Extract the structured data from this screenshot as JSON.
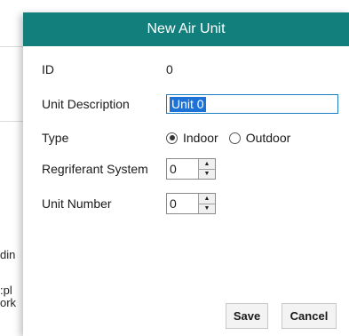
{
  "background": {
    "text_lines": [
      "din",
      ":pl",
      "ork"
    ]
  },
  "dialog": {
    "title": "New Air Unit",
    "id": {
      "label": "ID",
      "value": "0"
    },
    "unit_description": {
      "label": "Unit Description",
      "value": "Unit 0"
    },
    "type": {
      "label": "Type",
      "options": [
        "Indoor",
        "Outdoor"
      ],
      "selected": "Indoor"
    },
    "refrigerant_system": {
      "label": "Regriferant System",
      "value": "0"
    },
    "unit_number": {
      "label": "Unit Number",
      "value": "0"
    },
    "buttons": {
      "save": "Save",
      "cancel": "Cancel"
    }
  },
  "colors": {
    "titlebar": "#137f7c",
    "selection": "#1d72d8",
    "focus_border": "#1c7fc4"
  }
}
